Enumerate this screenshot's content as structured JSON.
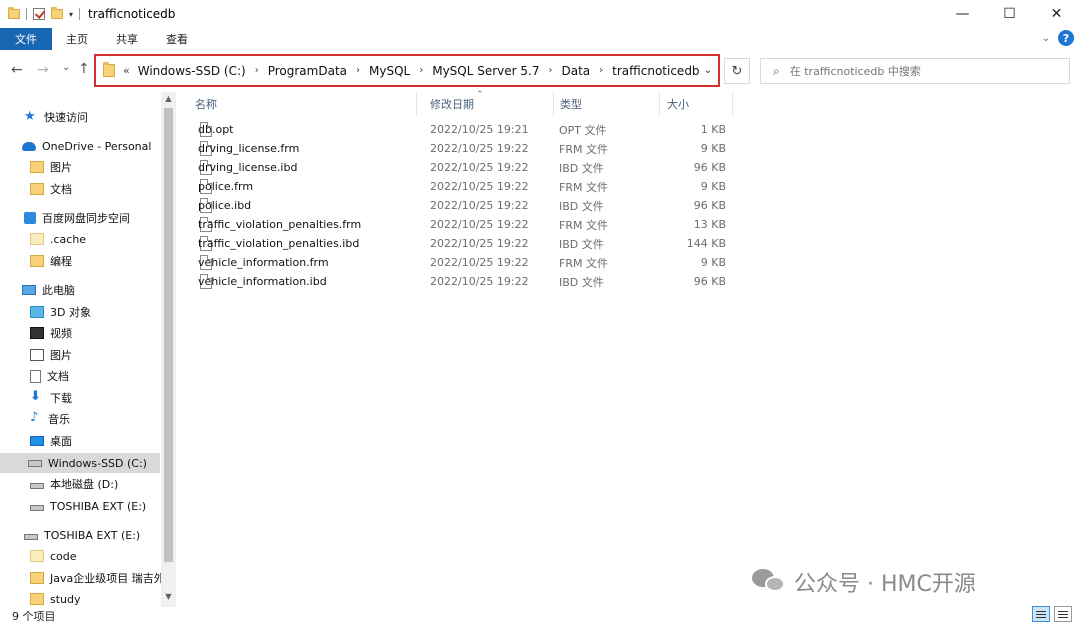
{
  "window": {
    "title": "trafficnoticedb",
    "controls": {
      "minimize": "—",
      "maximize": "☐",
      "close": "✕"
    }
  },
  "ribbon": {
    "tabs": [
      "文件",
      "主页",
      "共享",
      "查看"
    ],
    "help": "?",
    "expand": "⌄"
  },
  "nav": {
    "back": "←",
    "forward": "→",
    "recent": "⌄",
    "up": "↑",
    "refresh": "↻"
  },
  "address": {
    "overflow": "«",
    "crumbs": [
      "Windows-SSD (C:)",
      "ProgramData",
      "MySQL",
      "MySQL Server 5.7",
      "Data",
      "trafficnoticedb"
    ],
    "sep": "›",
    "dropdown": "⌄"
  },
  "search": {
    "placeholder": "在 trafficnoticedb 中搜索",
    "icon": "search-icon"
  },
  "sidebar": {
    "items": [
      {
        "label": "快速访问",
        "icon": "star"
      },
      {
        "label": "OneDrive - Personal",
        "icon": "cloud"
      },
      {
        "label": "图片",
        "icon": "folder"
      },
      {
        "label": "文档",
        "icon": "folder"
      },
      {
        "label": "百度网盘同步空间",
        "icon": "baidu"
      },
      {
        "label": ".cache",
        "icon": "folder-light"
      },
      {
        "label": "编程",
        "icon": "folder"
      },
      {
        "label": "此电脑",
        "icon": "pc"
      },
      {
        "label": "3D 对象",
        "icon": "3d"
      },
      {
        "label": "视频",
        "icon": "video"
      },
      {
        "label": "图片",
        "icon": "pictures"
      },
      {
        "label": "文档",
        "icon": "documents"
      },
      {
        "label": "下载",
        "icon": "download"
      },
      {
        "label": "音乐",
        "icon": "music"
      },
      {
        "label": "桌面",
        "icon": "desktop"
      },
      {
        "label": "Windows-SSD (C:)",
        "icon": "drive-windows",
        "selected": true
      },
      {
        "label": "本地磁盘 (D:)",
        "icon": "drive"
      },
      {
        "label": "TOSHIBA EXT (E:)",
        "icon": "drive"
      },
      {
        "label": "TOSHIBA EXT (E:)",
        "icon": "drive"
      },
      {
        "label": "code",
        "icon": "folder-light"
      },
      {
        "label": "Java企业级项目 瑞吉外",
        "icon": "folder"
      },
      {
        "label": "study",
        "icon": "folder"
      }
    ]
  },
  "columns": {
    "name": "名称",
    "date": "修改日期",
    "type": "类型",
    "size": "大小"
  },
  "files": [
    {
      "name": "db.opt",
      "date": "2022/10/25 19:21",
      "type": "OPT 文件",
      "size": "1 KB"
    },
    {
      "name": "drving_license.frm",
      "date": "2022/10/25 19:22",
      "type": "FRM 文件",
      "size": "9 KB"
    },
    {
      "name": "drving_license.ibd",
      "date": "2022/10/25 19:22",
      "type": "IBD 文件",
      "size": "96 KB"
    },
    {
      "name": "police.frm",
      "date": "2022/10/25 19:22",
      "type": "FRM 文件",
      "size": "9 KB"
    },
    {
      "name": "police.ibd",
      "date": "2022/10/25 19:22",
      "type": "IBD 文件",
      "size": "96 KB"
    },
    {
      "name": "traffic_violation_penalties.frm",
      "date": "2022/10/25 19:22",
      "type": "FRM 文件",
      "size": "13 KB"
    },
    {
      "name": "traffic_violation_penalties.ibd",
      "date": "2022/10/25 19:22",
      "type": "IBD 文件",
      "size": "144 KB"
    },
    {
      "name": "vehicle_information.frm",
      "date": "2022/10/25 19:22",
      "type": "FRM 文件",
      "size": "9 KB"
    },
    {
      "name": "vehicle_information.ibd",
      "date": "2022/10/25 19:22",
      "type": "IBD 文件",
      "size": "96 KB"
    }
  ],
  "status": {
    "count": "9 个项目"
  },
  "watermark": {
    "text": "公众号 · HMC开源"
  },
  "colors": {
    "accent": "#1966b2",
    "highlight": "#d32f2f",
    "selected": "#d9d9d9"
  }
}
